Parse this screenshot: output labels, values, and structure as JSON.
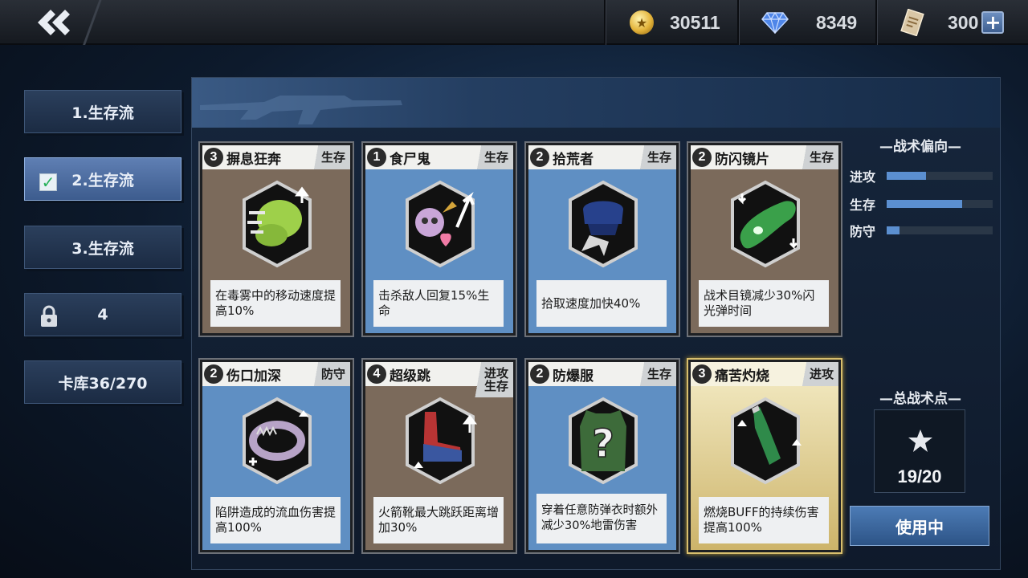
{
  "resources": {
    "gold": "30511",
    "diamond": "8349",
    "ticket": "300"
  },
  "tabs": [
    {
      "label": "1.生存流"
    },
    {
      "label": "2.生存流"
    },
    {
      "label": "3.生存流"
    },
    {
      "label": "4"
    },
    {
      "label": "卡库36/270"
    }
  ],
  "cards": [
    {
      "cost": "3",
      "name": "摒息狂奔",
      "tag": "生存",
      "desc": "在毒雾中的移动速度提高10%"
    },
    {
      "cost": "1",
      "name": "食尸鬼",
      "tag": "生存",
      "desc": "击杀敌人回复15%生命"
    },
    {
      "cost": "2",
      "name": "拾荒者",
      "tag": "生存",
      "desc": "拾取速度加快40%"
    },
    {
      "cost": "2",
      "name": "防闪镜片",
      "tag": "生存",
      "desc": "战术目镜减少30%闪光弹时间"
    },
    {
      "cost": "2",
      "name": "伤口加深",
      "tag": "防守",
      "desc": "陷阱造成的流血伤害提高100%"
    },
    {
      "cost": "4",
      "name": "超级跳",
      "tag": "进攻",
      "tag2": "生存",
      "desc": "火箭靴最大跳跃距离增加30%"
    },
    {
      "cost": "2",
      "name": "防爆服",
      "tag": "生存",
      "desc": "穿着任意防弹衣时额外减少30%地雷伤害"
    },
    {
      "cost": "3",
      "name": "痛苦灼烧",
      "tag": "进攻",
      "desc": "燃烧BUFF的持续伤害提高100%"
    }
  ],
  "tactics": {
    "title": "—战术偏向—",
    "rows": [
      {
        "label": "进攻",
        "level": 0.37
      },
      {
        "label": "生存",
        "level": 0.71
      },
      {
        "label": "防守",
        "level": 0.12
      }
    ]
  },
  "total": {
    "title": "—总战术点—",
    "value": "19/20"
  },
  "use_button": "使用中",
  "colors": {
    "survive_card": "#7b6a5b",
    "blue_card": "#5f8fc3",
    "gold_card": "#cdb46a",
    "accent": "#5b8fd0"
  }
}
